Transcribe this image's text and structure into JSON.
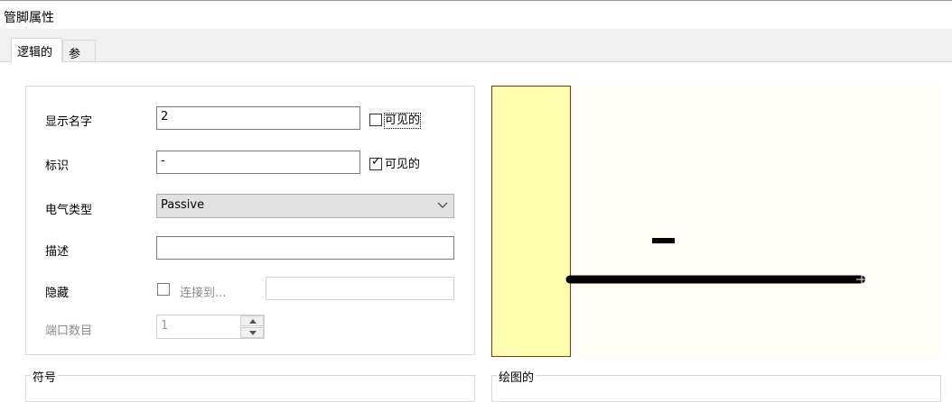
{
  "window": {
    "title": "管脚属性"
  },
  "tabs": [
    {
      "label": "逻辑的",
      "active": true
    },
    {
      "label": "参数",
      "active": false
    }
  ],
  "fields": {
    "display_name": {
      "label": "显示名字",
      "value": "2",
      "visible_label": "可见的",
      "visible_checked": false
    },
    "designator": {
      "label": "标识",
      "value": "-",
      "visible_label": "可见的",
      "visible_checked": true
    },
    "electrical_type": {
      "label": "电气类型",
      "value": "Passive"
    },
    "description": {
      "label": "描述",
      "value": ""
    },
    "hidden": {
      "label": "隐藏",
      "checked": false,
      "connect_to_label": "连接到...",
      "connect_to_value": ""
    },
    "port_count": {
      "label": "端口数目",
      "value": "1"
    }
  },
  "groups": {
    "symbol_label": "符号",
    "drawing_label": "绘图的"
  },
  "preview": {
    "pin_designator": "-",
    "colors": {
      "background": "#fffbf5",
      "body_fill": "#ffffb0",
      "body_border": "#8b2e12",
      "pin_line": "#000000"
    }
  },
  "icons": {
    "checkmark": "check-icon",
    "combo_arrow": "chevron-down-icon",
    "spin_up": "triangle-up-icon",
    "spin_down": "triangle-down-icon",
    "pin_end": "crosshair-icon"
  }
}
